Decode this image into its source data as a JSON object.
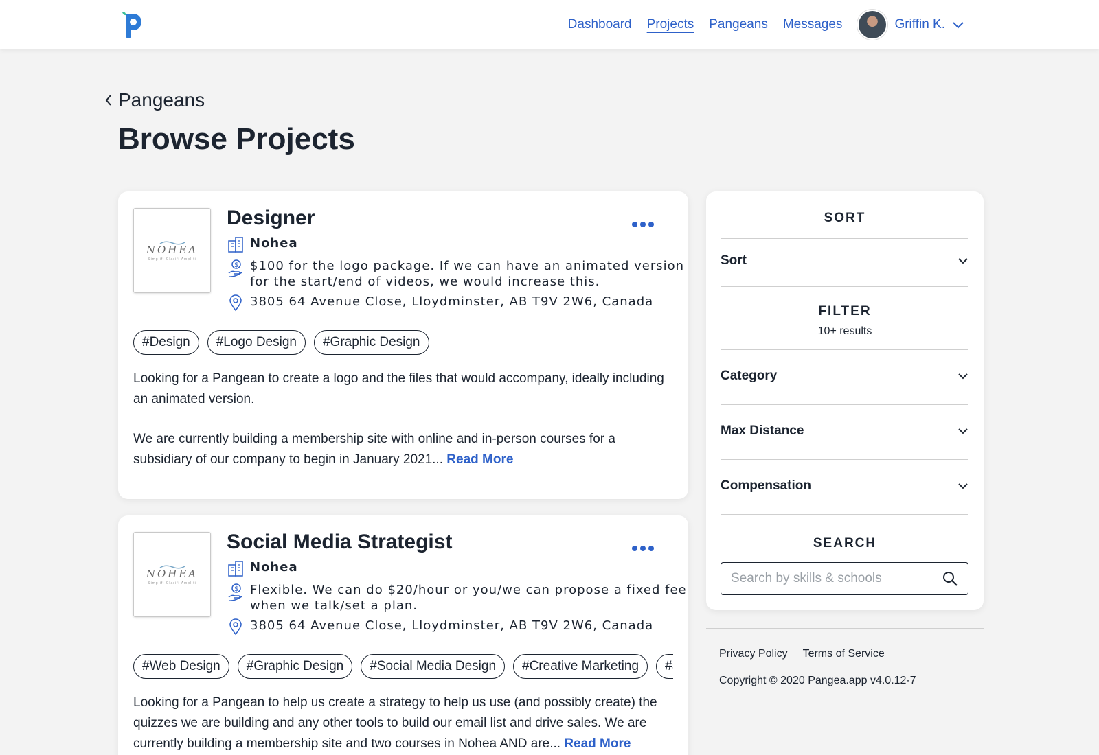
{
  "nav": {
    "items": [
      "Dashboard",
      "Projects",
      "Pangeans",
      "Messages"
    ],
    "active": "Projects",
    "user_name": "Griffin K."
  },
  "breadcrumb": {
    "back_label": "Pangeans"
  },
  "page": {
    "title": "Browse Projects"
  },
  "projects": [
    {
      "logo_text": "NOHEA",
      "logo_tagline": "Simplifi Clarifi Amplifi",
      "title": "Designer",
      "company": "Nohea",
      "compensation_line1": "$100 for the logo package. If we can have an animated version",
      "compensation_line2": "for the start/end of videos, we would increase this.",
      "location": "3805 64 Avenue Close, Lloydminster, AB T9V 2W6, Canada",
      "tags": [
        "#Design",
        "#Logo Design",
        "#Graphic Design"
      ],
      "desc_para1": "Looking for a Pangean to create a logo and the files that would accompany, ideally including an animated version.",
      "desc_para2": "We are currently building a membership site with online and in-person courses for a subsidiary of our company to begin in January 2021...",
      "read_more": "Read More"
    },
    {
      "logo_text": "NOHEA",
      "logo_tagline": "Simplifi Clarifi Amplifi",
      "title": "Social Media Strategist",
      "company": "Nohea",
      "compensation_line1": "Flexible. We can do $20/hour or you/we can propose a fixed fee",
      "compensation_line2": "when we talk/set a plan.",
      "location": "3805 64 Avenue Close, Lloydminster, AB T9V 2W6, Canada",
      "tags": [
        "#Web Design",
        "#Graphic Design",
        "#Social Media Design",
        "#Creative Marketing",
        "#S"
      ],
      "desc_para1": "Looking for a Pangean to help us create a strategy to help us use (and possibly create) the quizzes we are building and any other tools to build our email list and drive sales. We are currently building a membership site and two courses in Nohea AND are...",
      "read_more": "Read More"
    }
  ],
  "sidebar": {
    "sort_heading": "SORT",
    "sort_label": "Sort",
    "filter_heading": "FILTER",
    "filter_results": "10+ results",
    "filters": [
      "Category",
      "Max Distance",
      "Compensation"
    ],
    "search_heading": "SEARCH",
    "search_placeholder": "Search by skills & schools"
  },
  "footer": {
    "privacy": "Privacy Policy",
    "terms": "Terms of Service",
    "copyright": "Copyright © 2020 Pangea.app v4.0.12-7"
  },
  "colors": {
    "accent": "#2e61c9",
    "text": "#1c2430",
    "background": "#f3f3f3",
    "logo_green": "#3bbf9a"
  },
  "icons": [
    "logo-icon",
    "chevron-down-icon",
    "chevron-left-icon",
    "building-icon",
    "dollar-hand-icon",
    "location-pin-icon",
    "more-dots-icon",
    "search-icon"
  ]
}
